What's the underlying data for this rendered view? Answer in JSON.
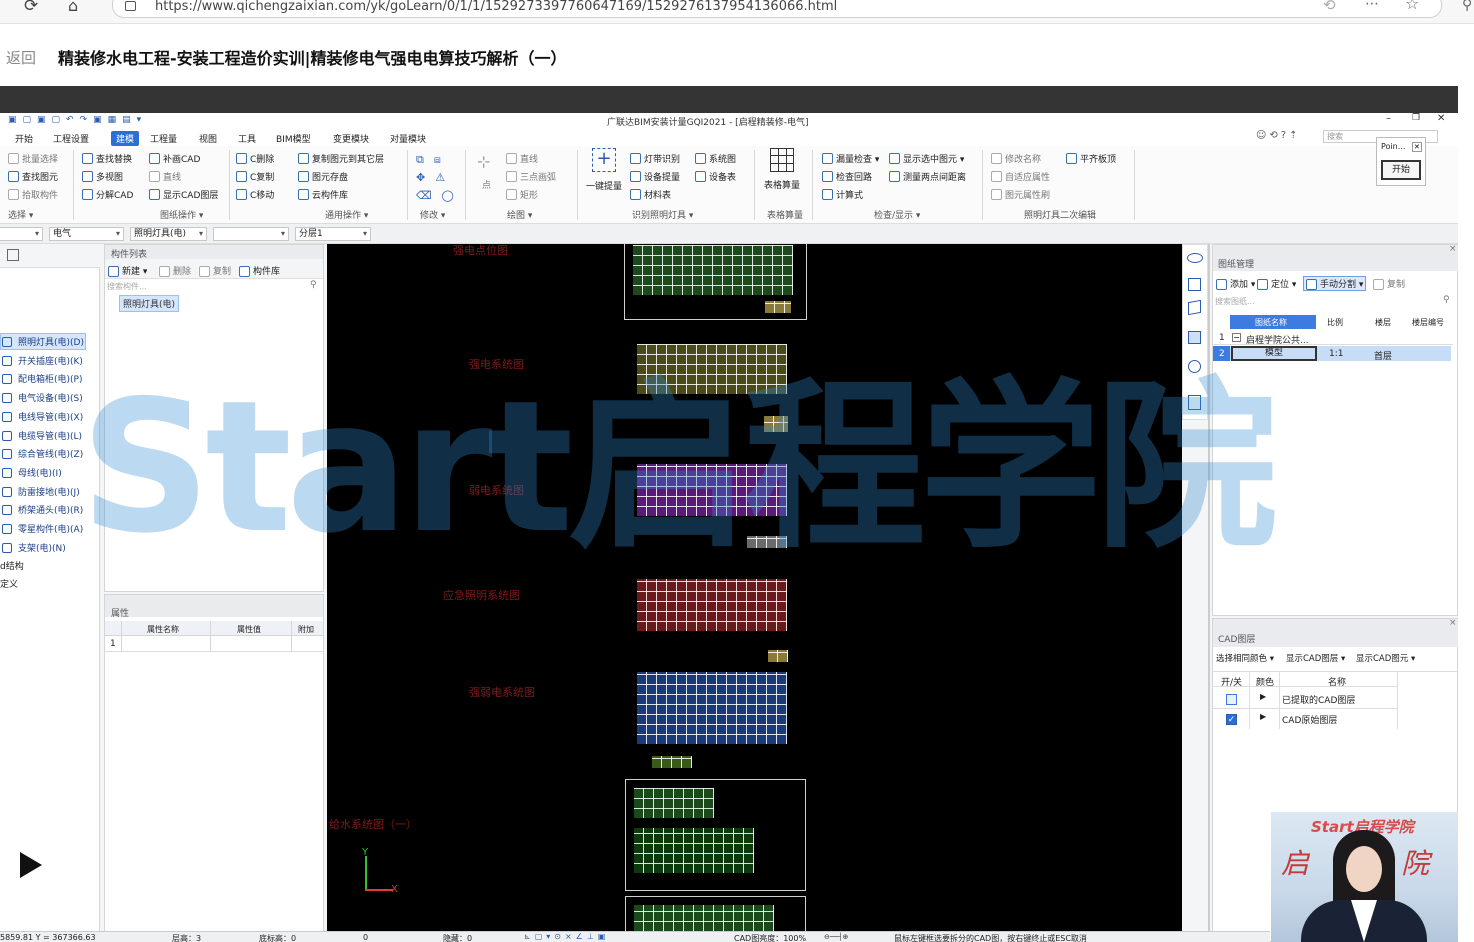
{
  "browser": {
    "url": "https://www.qichengzaixian.com/yk/goLearn/0/1/1/1529273397760647169/1529276137954136066.html"
  },
  "page": {
    "back": "返回",
    "title": "精装修水电工程-安装工程造价实训|精装修电气强电电算技巧解析（一）"
  },
  "app": {
    "window_title": "广联达BIM安装计量GQI2021 - [启程精装修-电气]",
    "menu": [
      "开始",
      "工程设置",
      "建模",
      "工程量",
      "视图",
      "工具",
      "BIM模型",
      "变更模块",
      "对量模块"
    ],
    "active_menu": "建模",
    "search_placeholder": "搜索",
    "ribbon": {
      "select": {
        "items": [
          "批量选择",
          "查找图元",
          "拾取构件"
        ],
        "group": "选择"
      },
      "drawing_ops": {
        "items": [
          "查找替换",
          "多视图",
          "分解CAD",
          "补画CAD",
          "直线",
          "显示CAD图层"
        ],
        "group": "图纸操作"
      },
      "common_ops": {
        "items": [
          "C删除",
          "C复制",
          "C移动",
          "复制图元到其它层",
          "图元存盘",
          "云构件库"
        ],
        "group": "通用操作"
      },
      "modify": {
        "group": "修改"
      },
      "draw": {
        "items": [
          "直线",
          "三点画弧",
          "矩形",
          "点"
        ],
        "group": "绘图"
      },
      "recognize": {
        "items": [
          "一键提量",
          "灯带识别",
          "设备提量",
          "材料表",
          "系统图",
          "设备表"
        ],
        "group": "识别照明灯具"
      },
      "table": {
        "items": [
          "表格算量"
        ],
        "group": "表格算量"
      },
      "check": {
        "items": [
          "漏量检查",
          "检查回路",
          "计算式",
          "显示选中图元",
          "测量两点间距离"
        ],
        "group": "检查/显示"
      },
      "edit2": {
        "items": [
          "修改名称",
          "自适应属性",
          "图元属性刷",
          "平齐板顶"
        ],
        "group": "照明灯具二次编辑"
      }
    },
    "toolbar_selects": [
      "电气",
      "照明灯具(电)",
      "",
      "分层1"
    ],
    "side_panel": {
      "title": "Poin...",
      "button": "开始"
    },
    "nav_tree": {
      "items": [
        "照明灯具(电)(D)",
        "开关插座(电)(K)",
        "配电箱柜(电)(P)",
        "电气设备(电)(S)",
        "电线导管(电)(X)",
        "电缆导管(电)(L)",
        "综合管线(电)(Z)",
        "母线(电)(I)",
        "防雷接地(电)(J)",
        "桥架通头(电)(R)",
        "零星构件(电)(A)",
        "支架(电)(N)"
      ],
      "tail": [
        "d结构",
        "定义"
      ]
    },
    "component_list": {
      "title": "构件列表",
      "new": "新建",
      "delete": "删除",
      "copy": "复制",
      "library": "构件库",
      "search_placeholder": "搜索构件...",
      "selected": "照明灯具(电)"
    },
    "properties": {
      "title": "属性",
      "headers": [
        "属性名称",
        "属性值",
        "附加"
      ],
      "row1": "1"
    },
    "drawing_labels": [
      "强电点位图",
      "强电系统图",
      "弱电系统图",
      "应急照明系统图",
      "强弱电系统图",
      "给水系统图（一）"
    ],
    "axis": {
      "x": "X",
      "y": "Y"
    },
    "drawing_mgmt": {
      "title": "图纸管理",
      "add": "添加",
      "locate": "定位",
      "split": "手动分割",
      "copy": "复制",
      "search_placeholder": "搜索图纸...",
      "headers": [
        "图纸名称",
        "比例",
        "楼层",
        "楼层编号"
      ],
      "rows": [
        {
          "no": "1",
          "name": "启程学院公共...",
          "scale": "",
          "floor": "",
          "code": ""
        },
        {
          "no": "2",
          "name": "模型",
          "scale": "1:1",
          "floor": "首层",
          "code": ""
        }
      ]
    },
    "cad_layers": {
      "title": "CAD图层",
      "tools": [
        "选择相同颜色",
        "显示CAD图层",
        "显示CAD图元"
      ],
      "headers": [
        "开/关",
        "颜色",
        "名称"
      ],
      "rows": [
        {
          "name": "已提取的CAD图层",
          "checked": false
        },
        {
          "name": "CAD原始图层",
          "checked": true
        }
      ]
    },
    "status": {
      "coords": "5859.81 Y = 367366.63",
      "floor_h": "层高：3",
      "base_h": "底标高：0",
      "val": "0",
      "hidden": "隐藏：0",
      "cad_bright": "CAD图亮度：100%",
      "hint": "鼠标左键框选要拆分的CAD图，按右键终止或ESC取消"
    }
  },
  "watermark": {
    "text": "Start启程学院"
  },
  "video": {
    "overlay": "Start启程学院",
    "play": "play-icon"
  }
}
